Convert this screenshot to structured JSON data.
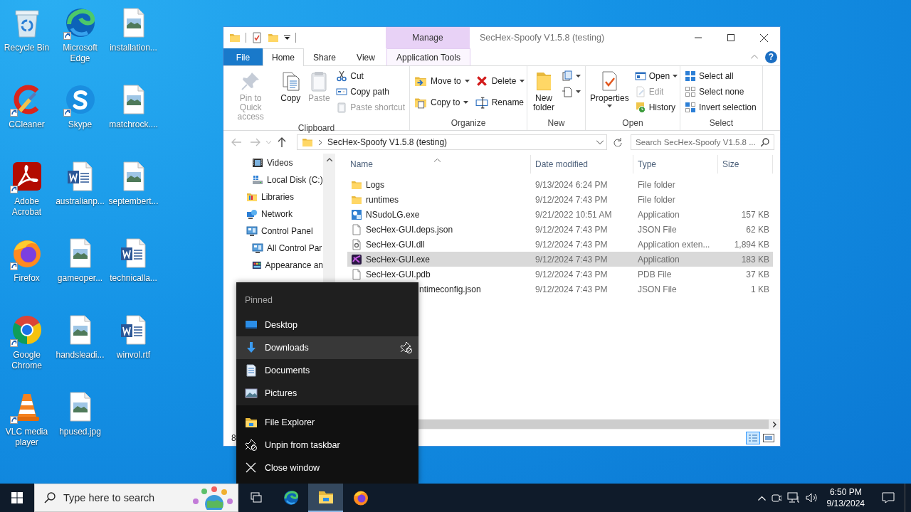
{
  "desktop": {
    "icons": [
      {
        "label": "Recycle Bin",
        "kind": "recycle",
        "shortcut": false
      },
      {
        "label": "Microsoft Edge",
        "kind": "edge",
        "shortcut": true
      },
      {
        "label": "installation...",
        "kind": "image",
        "shortcut": false
      },
      {
        "label": "CCleaner",
        "kind": "ccleaner",
        "shortcut": true
      },
      {
        "label": "Skype",
        "kind": "skype",
        "shortcut": true
      },
      {
        "label": "matchrock....",
        "kind": "image",
        "shortcut": false
      },
      {
        "label": "Adobe Acrobat",
        "kind": "acrobat",
        "shortcut": true
      },
      {
        "label": "australianp...",
        "kind": "word",
        "shortcut": false
      },
      {
        "label": "septembert...",
        "kind": "image",
        "shortcut": false
      },
      {
        "label": "Firefox",
        "kind": "firefox",
        "shortcut": true
      },
      {
        "label": "gameoper...",
        "kind": "image",
        "shortcut": false
      },
      {
        "label": "technicalla...",
        "kind": "word",
        "shortcut": false
      },
      {
        "label": "Google Chrome",
        "kind": "chrome",
        "shortcut": true
      },
      {
        "label": "handsleadi...",
        "kind": "image",
        "shortcut": false
      },
      {
        "label": "winvol.rtf",
        "kind": "word",
        "shortcut": false
      },
      {
        "label": "VLC media player",
        "kind": "vlc",
        "shortcut": true
      },
      {
        "label": "hpused.jpg",
        "kind": "image",
        "shortcut": false
      }
    ]
  },
  "explorer": {
    "title": "SecHex-Spoofy V1.5.8 (testing)",
    "context_label": "Manage",
    "tabs": [
      {
        "label": "File",
        "kind": "file",
        "selected": false
      },
      {
        "label": "Home",
        "kind": "normal",
        "selected": true
      },
      {
        "label": "Share",
        "kind": "normal",
        "selected": false
      },
      {
        "label": "View",
        "kind": "normal",
        "selected": false
      },
      {
        "label": "Application Tools",
        "kind": "context",
        "selected": false
      }
    ],
    "help": "?",
    "ribbon": [
      {
        "label": "Clipboard",
        "items": [
          {
            "label": "Pin to Quick access",
            "kind": "large",
            "disabled": true,
            "dropdown": false
          },
          {
            "label": "Copy",
            "kind": "large",
            "disabled": false,
            "dropdown": false
          },
          {
            "label": "Paste",
            "kind": "large",
            "disabled": true,
            "dropdown": false
          },
          {
            "label": "Cut",
            "kind": "small",
            "disabled": false,
            "dropdown": false
          },
          {
            "label": "Copy path",
            "kind": "small",
            "disabled": false,
            "dropdown": false
          },
          {
            "label": "Paste shortcut",
            "kind": "small",
            "disabled": true,
            "dropdown": false
          }
        ]
      },
      {
        "label": "Organize",
        "items": [
          {
            "label": "Move to",
            "kind": "medium",
            "disabled": false,
            "dropdown": true
          },
          {
            "label": "Copy to",
            "kind": "medium",
            "disabled": false,
            "dropdown": true
          },
          {
            "label": "Delete",
            "kind": "medium",
            "disabled": false,
            "dropdown": true
          },
          {
            "label": "Rename",
            "kind": "medium",
            "disabled": false,
            "dropdown": false
          }
        ]
      },
      {
        "label": "New",
        "items": [
          {
            "label": "New folder",
            "kind": "large",
            "disabled": false,
            "dropdown": false
          },
          {
            "kind": "icon",
            "disabled": false,
            "dropdown": true
          },
          {
            "kind": "icon",
            "disabled": false,
            "dropdown": true
          }
        ]
      },
      {
        "label": "Open",
        "items": [
          {
            "label": "Properties",
            "kind": "large",
            "disabled": false,
            "dropdown": true
          },
          {
            "label": "Open",
            "kind": "small",
            "disabled": false,
            "dropdown": true
          },
          {
            "label": "Edit",
            "kind": "small",
            "disabled": true,
            "dropdown": false
          },
          {
            "label": "History",
            "kind": "small",
            "disabled": false,
            "dropdown": false
          }
        ]
      },
      {
        "label": "Select",
        "items": [
          {
            "label": "Select all",
            "kind": "small",
            "disabled": false,
            "dropdown": false
          },
          {
            "label": "Select none",
            "kind": "small",
            "disabled": false,
            "dropdown": false
          },
          {
            "label": "Invert selection",
            "kind": "small",
            "disabled": false,
            "dropdown": false
          }
        ]
      }
    ],
    "address": "SecHex-Spoofy V1.5.8 (testing)",
    "search_placeholder": "Search SecHex-Spoofy V1.5.8 ...",
    "navigation": {
      "continued_children": [
        {
          "label": "Videos",
          "kind": "videos"
        },
        {
          "label": "Local Disk (C:)",
          "kind": "disk"
        }
      ],
      "items": [
        {
          "label": "Libraries",
          "kind": "libraries"
        },
        {
          "label": "Network",
          "kind": "network"
        },
        {
          "label": "Control Panel",
          "kind": "control-panel",
          "children": [
            {
              "label": "All Control Par",
              "kind": "control-panel"
            },
            {
              "label": "Appearance an",
              "kind": "appearance"
            }
          ]
        }
      ]
    },
    "columns": [
      "Name",
      "Date modified",
      "Type",
      "Size"
    ],
    "files": [
      {
        "name": "Logs",
        "date": "9/13/2024 6:24 PM",
        "type": "File folder",
        "kind": "folder",
        "selected": false
      },
      {
        "name": "runtimes",
        "date": "9/12/2024 7:43 PM",
        "type": "File folder",
        "kind": "folder",
        "selected": false
      },
      {
        "name": "NSudoLG.exe",
        "date": "9/21/2022 10:51 AM",
        "type": "Application",
        "size": "157 KB",
        "kind": "app",
        "selected": false
      },
      {
        "name": "SecHex-GUI.deps.json",
        "date": "9/12/2024 7:43 PM",
        "type": "JSON File",
        "size": "62 KB",
        "kind": "file",
        "selected": false
      },
      {
        "name": "SecHex-GUI.dll",
        "date": "9/12/2024 7:43 PM",
        "type": "Application exten...",
        "size": "1,894 KB",
        "kind": "dll",
        "selected": false
      },
      {
        "name": "SecHex-GUI.exe",
        "date": "9/12/2024 7:43 PM",
        "type": "Application",
        "size": "183 KB",
        "kind": "exe",
        "selected": true
      },
      {
        "name": "SecHex-GUI.pdb",
        "date": "9/12/2024 7:43 PM",
        "type": "PDB File",
        "size": "37 KB",
        "kind": "file",
        "selected": false
      },
      {
        "name": "ntimeconfig.json",
        "date": "9/12/2024 7:43 PM",
        "type": "JSON File",
        "size": "1 KB",
        "kind": "covered",
        "selected": false
      }
    ],
    "status_bar": "8"
  },
  "jump_list": {
    "heading": "Pinned",
    "pinned": [
      {
        "label": "Desktop",
        "kind": "desktop",
        "highlighted": false
      },
      {
        "label": "Downloads",
        "kind": "downloads",
        "highlighted": true
      },
      {
        "label": "Documents",
        "kind": "documents",
        "highlighted": false
      },
      {
        "label": "Pictures",
        "kind": "pictures",
        "highlighted": false
      }
    ],
    "tasks": [
      {
        "label": "File Explorer",
        "kind": "explorer"
      },
      {
        "label": "Unpin from taskbar",
        "kind": "unpin"
      },
      {
        "label": "Close window",
        "kind": "close"
      }
    ]
  },
  "taskbar": {
    "search_placeholder": "Type here to search",
    "apps": [
      {
        "kind": "task-view",
        "active": false
      },
      {
        "kind": "edge",
        "active": false
      },
      {
        "kind": "explorer",
        "active": true
      },
      {
        "kind": "firefox",
        "active": false
      }
    ],
    "time": "6:50 PM",
    "date": "9/13/2024"
  }
}
